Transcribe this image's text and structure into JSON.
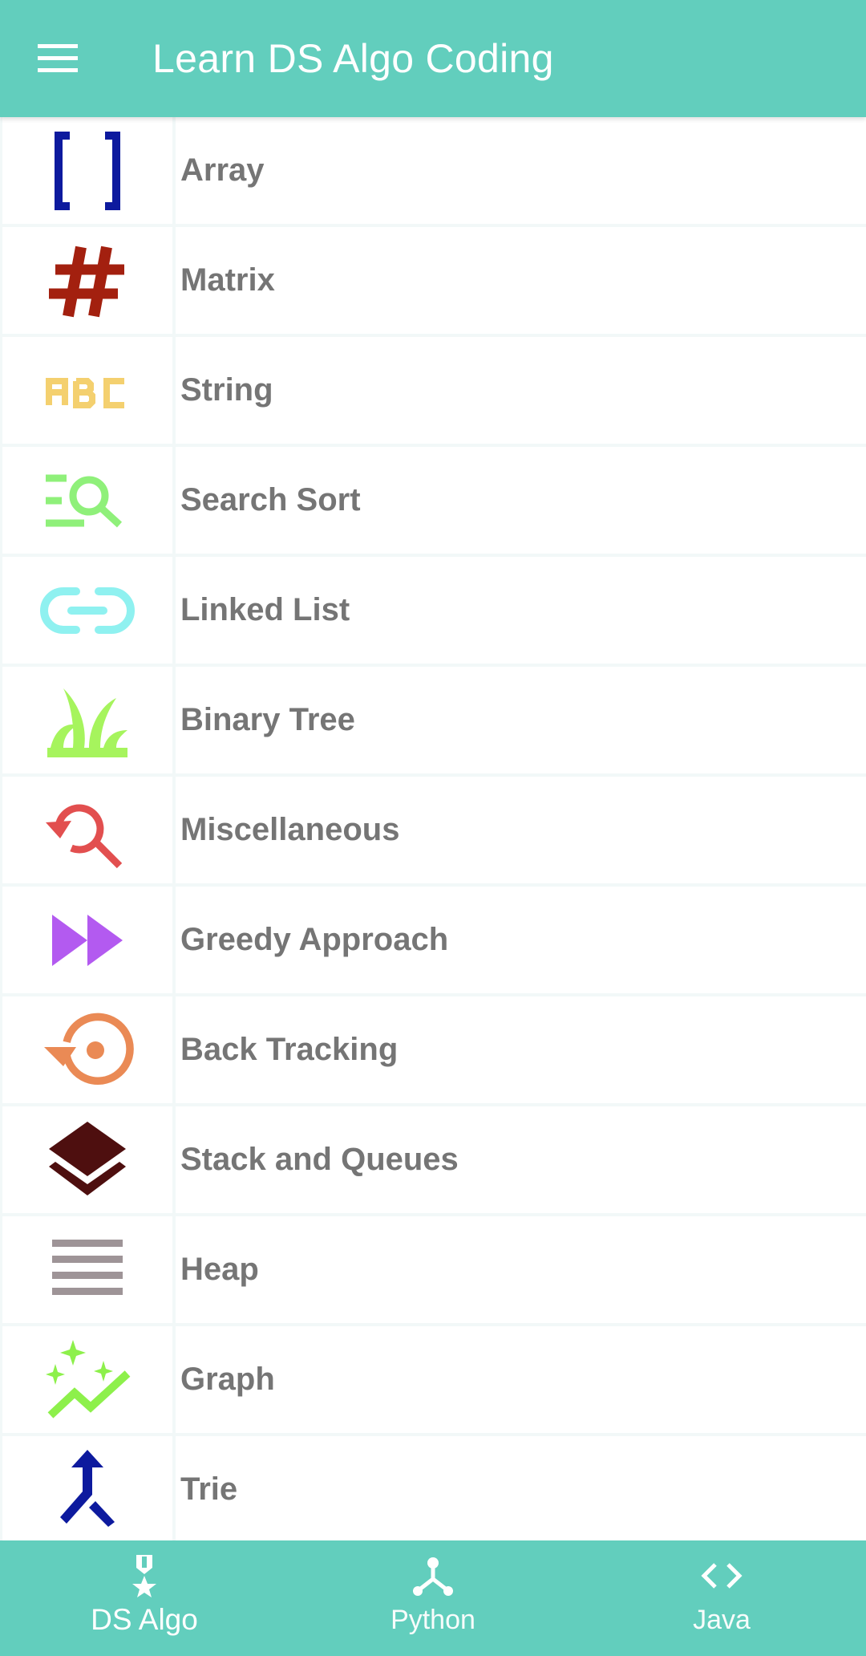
{
  "app_bar": {
    "title": "Learn DS Algo Coding",
    "menu_icon": "hamburger-menu-icon",
    "background": "#62cebd"
  },
  "topics": [
    {
      "label": "Array",
      "icon": "brackets-icon",
      "color": "#0d1a9e"
    },
    {
      "label": "Matrix",
      "icon": "hash-icon",
      "color": "#a3200f"
    },
    {
      "label": "String",
      "icon": "abc-icon",
      "color": "#f4d06f"
    },
    {
      "label": "Search Sort",
      "icon": "search-list-icon",
      "color": "#8ff07a"
    },
    {
      "label": "Linked List",
      "icon": "link-icon",
      "color": "#8ff1f0"
    },
    {
      "label": "Binary Tree",
      "icon": "grass-icon",
      "color": "#a6f45d"
    },
    {
      "label": "Miscellaneous",
      "icon": "search-refresh-icon",
      "color": "#e24f4f"
    },
    {
      "label": "Greedy Approach",
      "icon": "fast-forward-icon",
      "color": "#b35af0"
    },
    {
      "label": "Back Tracking",
      "icon": "restore-icon",
      "color": "#ea8a55"
    },
    {
      "label": "Stack and Queues",
      "icon": "layers-icon",
      "color": "#4e0f0f"
    },
    {
      "label": "Heap",
      "icon": "heap-lines-icon",
      "color": "#9e9497"
    },
    {
      "label": "Graph",
      "icon": "sparkle-trend-icon",
      "color": "#8df04b"
    },
    {
      "label": "Trie",
      "icon": "merge-arrow-icon",
      "color": "#0d1a9e"
    }
  ],
  "bottom_nav": [
    {
      "label": "DS Algo",
      "icon": "medal-icon",
      "active": true
    },
    {
      "label": "Python",
      "icon": "hub-icon",
      "active": false
    },
    {
      "label": "Java",
      "icon": "code-icon",
      "active": false
    }
  ]
}
